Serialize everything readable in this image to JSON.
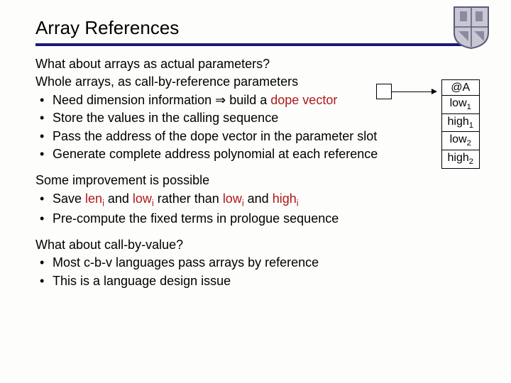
{
  "title": "Array References",
  "logo_alt": "shield-crest",
  "intro": "What about arrays as actual parameters?",
  "block1": {
    "lead": "Whole arrays, as call-by-reference parameters",
    "b1a": "Need dimension information ",
    "b1_arrow": "⇒",
    "b1b": " build a ",
    "b1_dv": "dope vector",
    "b2": "Store the values in the calling sequence",
    "b3": "Pass the address of the dope vector in the parameter slot",
    "b4": "Generate complete address polynomial at each reference"
  },
  "block2": {
    "lead": "Some improvement is possible",
    "b1a": "Save ",
    "b1_len": "len",
    "b1b": " and ",
    "b1_low1": "low",
    "b1c": " rather than ",
    "b1_low2": "low",
    "b1d": " and ",
    "b1_high": "high",
    "b2": "Pre-compute the fixed terms in prologue sequence"
  },
  "block3": {
    "lead": "What about call-by-value?",
    "b1": "Most c-b-v languages pass arrays by reference",
    "b2": "This is a language design issue"
  },
  "dope": {
    "r0": "@A",
    "r1a": "low",
    "r1b": "1",
    "r2a": "high",
    "r2b": "1",
    "r3a": "low",
    "r3b": "2",
    "r4a": "high",
    "r4b": "2"
  },
  "sub_i": "i"
}
